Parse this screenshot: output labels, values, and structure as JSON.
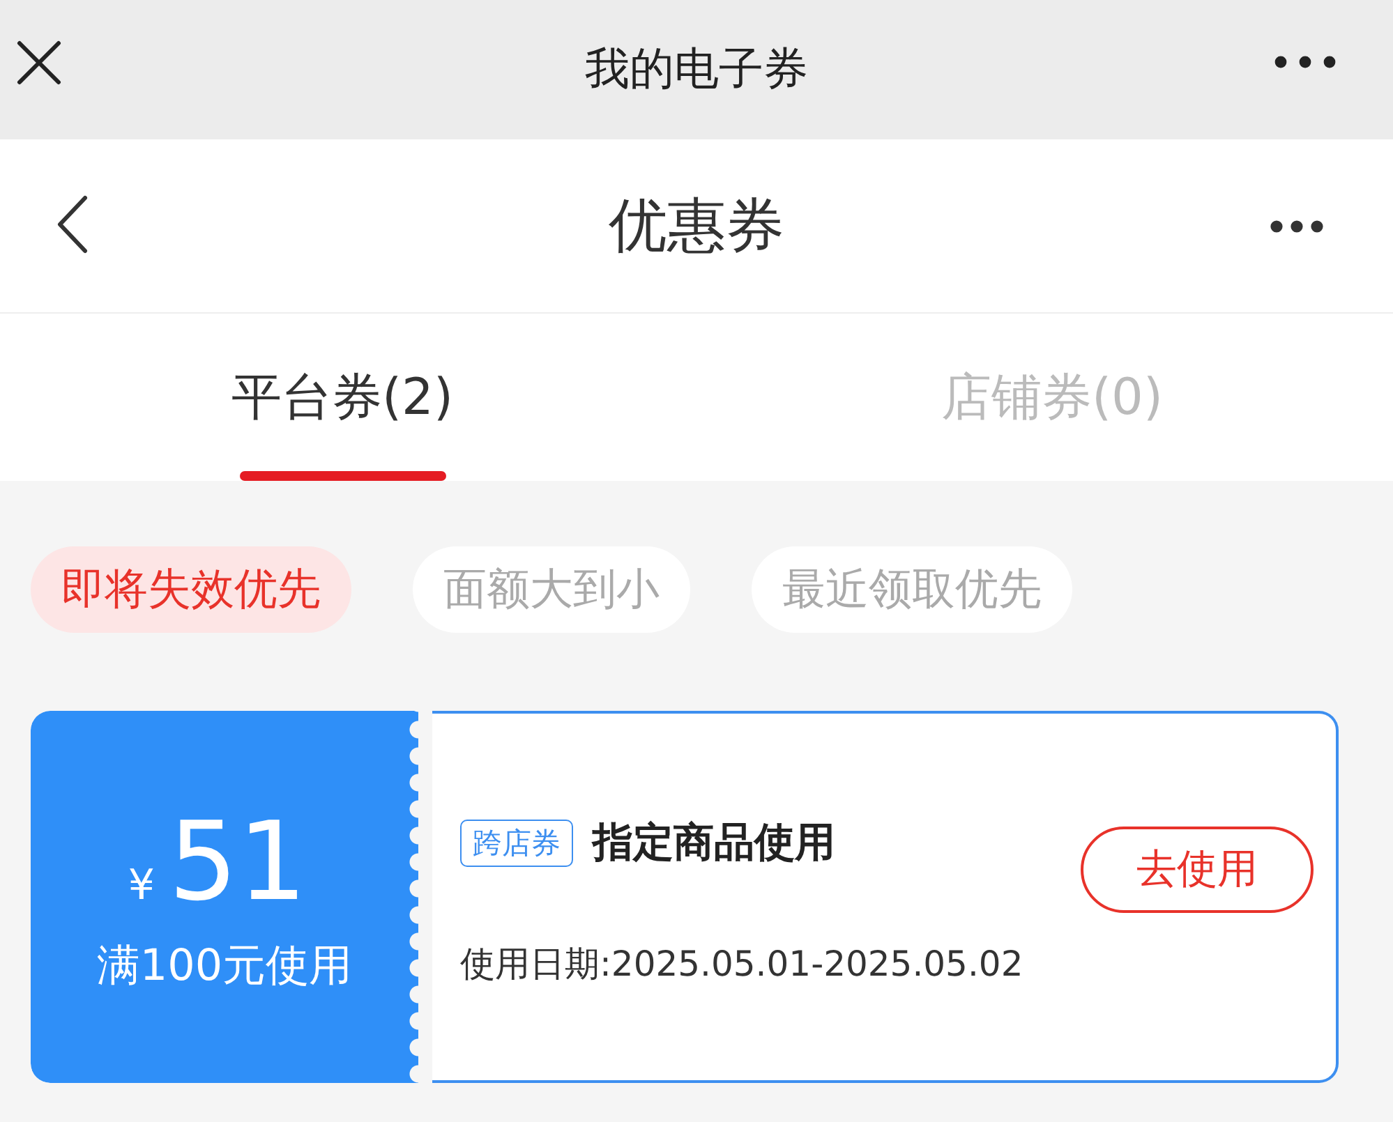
{
  "top_bar": {
    "title": "我的电子券"
  },
  "header": {
    "title": "优惠券"
  },
  "tabs": [
    {
      "label": "平台券(2)",
      "selected": true
    },
    {
      "label": "店铺券(0)",
      "selected": false
    }
  ],
  "filters": [
    {
      "label": "即将失效优先",
      "selected": true
    },
    {
      "label": "面额大到小",
      "selected": false
    },
    {
      "label": "最近领取优先",
      "selected": false
    }
  ],
  "coupons": [
    {
      "currency": "¥",
      "amount": "51",
      "condition": "满100元使用",
      "tag": "跨店券",
      "title": "指定商品使用",
      "validity": "使用日期:2025.05.01-2025.05.02",
      "button": "去使用"
    }
  ]
}
